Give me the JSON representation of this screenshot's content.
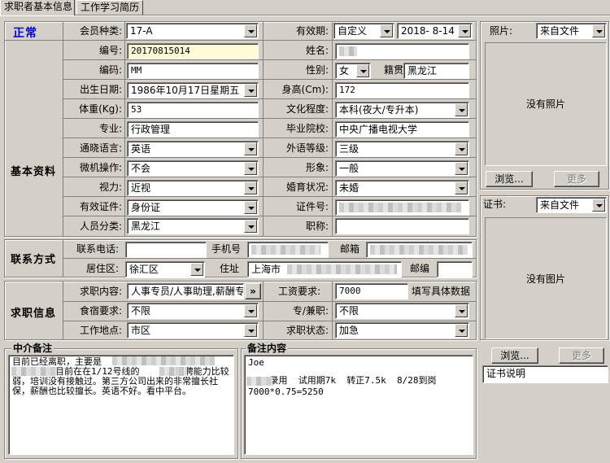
{
  "tabs": [
    {
      "label": "求职者基本信息",
      "active": true
    },
    {
      "label": "工作学习简历",
      "active": false
    }
  ],
  "status": "正常",
  "sections": {
    "basic": "基本资料",
    "contact": "联系方式",
    "job": "求职信息"
  },
  "fields": {
    "member_type_label": "会员种类:",
    "member_type": "17-A",
    "validity_label": "有效期:",
    "validity_mode": "自定义",
    "validity_date": "2018- 8-14",
    "id_label": "编号:",
    "id": "20170815014",
    "name_label": "姓名:",
    "code_label": "编码:",
    "code": "MM",
    "gender_label": "性别:",
    "gender": "女",
    "native_label": "籍贯",
    "native": "黑龙江",
    "birth_label": "出生日期:",
    "birth": "1986年10月17日星期五",
    "height_label": "身高(Cm):",
    "height": "172",
    "weight_label": "体重(Kg):",
    "weight": "53",
    "education_label": "文化程度:",
    "education": "本科(夜大/专升本)",
    "major_label": "专业:",
    "major": "行政管理",
    "school_label": "毕业院校:",
    "school": "中央广播电视大学",
    "language_label": "通晓语言:",
    "language": "英语",
    "foreign_level_label": "外语等级:",
    "foreign_level": "三级",
    "computer_label": "微机操作:",
    "computer": "不会",
    "appearance_label": "形象:",
    "appearance": "一般",
    "vision_label": "视力:",
    "vision": "近视",
    "marital_label": "婚育状况:",
    "marital": "未婚",
    "cert_type_label": "有效证件:",
    "cert_type": "身份证",
    "cert_no_label": "证件号:",
    "category_label": "人员分类:",
    "category": "黑龙江",
    "title_label": "职称:",
    "phone_label": "联系电话:",
    "mobile_label": "手机号",
    "email_label": "邮箱",
    "district_label": "居住区:",
    "district": "徐汇区",
    "address_label": "住址",
    "address": "上海市",
    "postcode_label": "邮编",
    "job_content_label": "求职内容:",
    "job_content": "人事专员/人事助理,薪酬专",
    "salary_label": "工资要求:",
    "salary": "7000",
    "salary_hint": "填写具体数据",
    "board_label": "食宿要求:",
    "board": "不限",
    "parttime_label": "专/兼职:",
    "parttime": "不限",
    "location_label": "工作地点:",
    "location": "市区",
    "job_status_label": "求职状态:",
    "job_status": "加急"
  },
  "right": {
    "photo_label": "照片:",
    "photo_source": "来自文件",
    "no_photo": "没有照片",
    "browse": "浏览...",
    "more": "更多",
    "cert_label": "证书:",
    "cert_source": "来自文件",
    "no_image": "没有图片",
    "browse2": "浏览...",
    "more2": "更多",
    "cert_desc": "证书说明"
  },
  "notes": {
    "agent_title": "中介备注",
    "agent_text": "目前已经离职，主要是\n        目前在在1/12号线的     。招聘能力比较弱，培训没有接触过。第三方公司出来的非常擅长社保，薪酬也比较擅长。英语不好。看中平台。",
    "remark_title": "备注内容",
    "remark_line1": "Joe",
    "remark_line2": "    录用  试用期7k  转正7.5k  8/28到岗",
    "remark_line3": "7000*0.75=5250"
  }
}
